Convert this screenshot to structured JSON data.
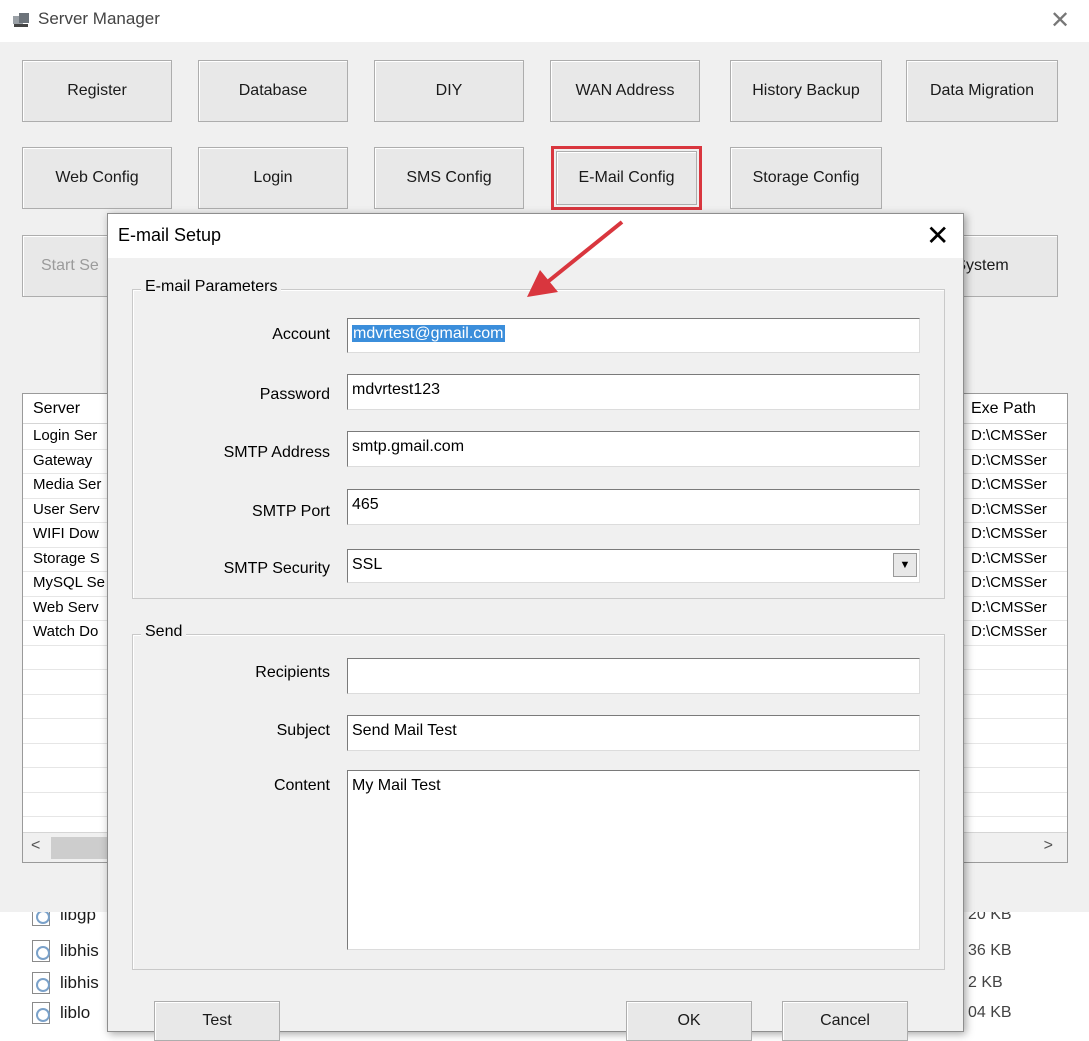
{
  "window": {
    "title": "Server Manager",
    "close_glyph": "✕"
  },
  "toolbar": {
    "row1": [
      "Register",
      "Database",
      "DIY",
      "WAN Address",
      "History Backup",
      "Data Migration"
    ],
    "row2": [
      "Web Config",
      "Login",
      "SMS Config",
      "E-Mail Config",
      "Storage Config"
    ],
    "row3": {
      "left": "Start Se",
      "right": "System"
    }
  },
  "server_list": {
    "columns": {
      "server": "Server",
      "exe_path": "Exe Path"
    },
    "rows": [
      {
        "name": "Login Ser",
        "path": "D:\\CMSSer"
      },
      {
        "name": "Gateway",
        "path": "D:\\CMSSer"
      },
      {
        "name": "Media Ser",
        "path": "D:\\CMSSer"
      },
      {
        "name": "User Serv",
        "path": "D:\\CMSSer"
      },
      {
        "name": "WIFI Dow",
        "path": "D:\\CMSSer"
      },
      {
        "name": "Storage S",
        "path": "D:\\CMSSer"
      },
      {
        "name": "MySQL Se",
        "path": "D:\\CMSSer"
      },
      {
        "name": "Web Serv",
        "path": "D:\\CMSSer"
      },
      {
        "name": "Watch Do",
        "path": "D:\\CMSSer"
      }
    ],
    "scroll_left": "<",
    "scroll_right": ">"
  },
  "background_files": [
    {
      "name": "libgp",
      "size": "20 KB"
    },
    {
      "name": "libhis",
      "size": "36 KB"
    },
    {
      "name": "libhis",
      "size": "2 KB"
    },
    {
      "name": "liblo",
      "size": "04 KB"
    }
  ],
  "dialog": {
    "title": "E-mail Setup",
    "close_glyph": "✕",
    "params_group": "E-mail Parameters",
    "send_group": "Send",
    "labels": {
      "account": "Account",
      "password": "Password",
      "smtp_address": "SMTP Address",
      "smtp_port": "SMTP Port",
      "smtp_security": "SMTP Security",
      "recipients": "Recipients",
      "subject": "Subject",
      "content": "Content"
    },
    "values": {
      "account": "mdvrtest@gmail.com",
      "password": "mdvrtest123",
      "smtp_address": "smtp.gmail.com",
      "smtp_port": "465",
      "smtp_security": "SSL",
      "recipients": "",
      "subject": "Send Mail Test",
      "content": "My Mail Test"
    },
    "buttons": {
      "test": "Test",
      "ok": "OK",
      "cancel": "Cancel"
    }
  },
  "colors": {
    "highlight": "#d9363e",
    "selection": "#3b8edb"
  }
}
